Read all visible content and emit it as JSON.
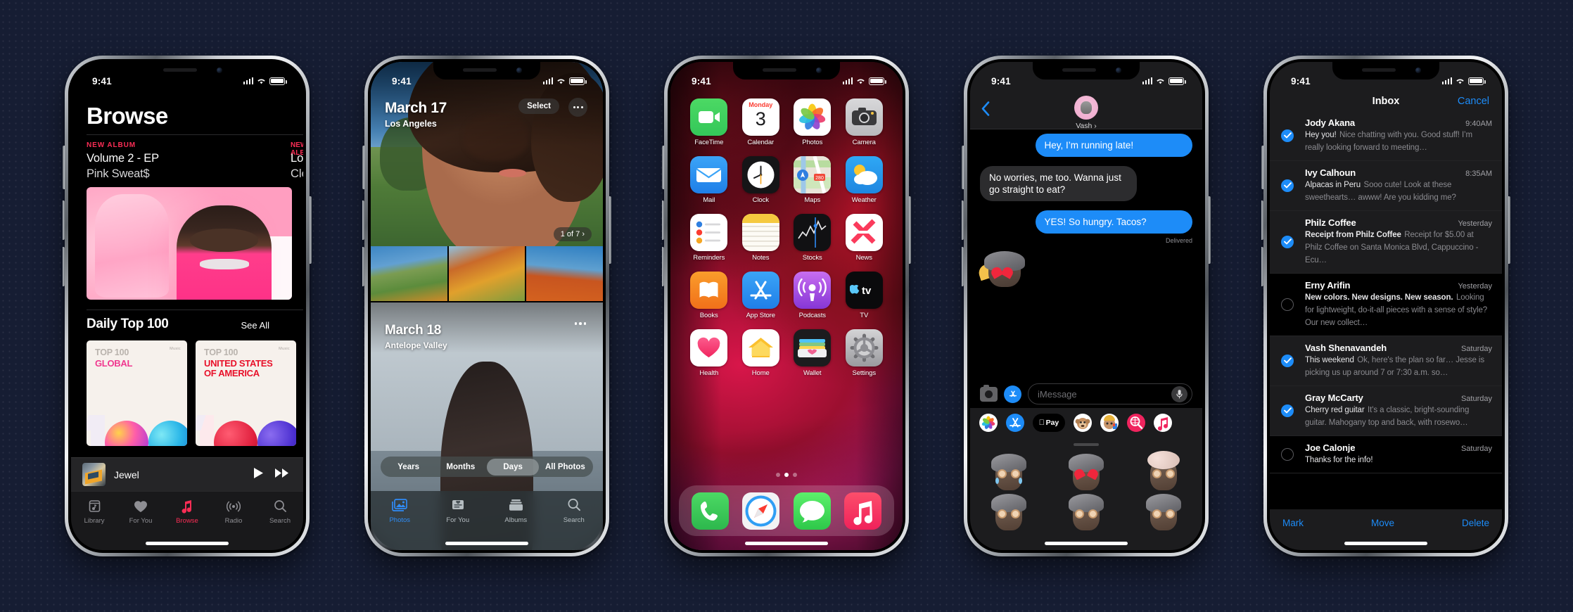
{
  "status_bar": {
    "time": "9:41",
    "signal_icon": "cellular-bars-icon",
    "wifi_icon": "wifi-icon",
    "battery_icon": "battery-icon"
  },
  "phones": [
    {
      "id": "music",
      "app": "Apple Music",
      "page_title": "Browse",
      "eyebrow": "NEW ALBUM",
      "album_title": "Volume 2 - EP",
      "album_artist": "Pink Sweat$",
      "eyebrow2": "NEW ALBUM",
      "album_title2": "Love Goes",
      "album_artist2": "Cloudy",
      "section_title": "Daily Top 100",
      "see_all": "See All",
      "cards": [
        {
          "top": "TOP 100",
          "name": "GLOBAL",
          "badge": "Music"
        },
        {
          "top": "TOP 100",
          "name": "UNITED STATES OF AMERICA",
          "badge": "Music"
        }
      ],
      "now_playing": {
        "track": "Jewel",
        "play_icon": "play-icon",
        "next_icon": "fast-forward-icon"
      },
      "tabs": [
        {
          "label": "Library",
          "icon": "library-icon",
          "active": false
        },
        {
          "label": "For You",
          "icon": "heart-icon",
          "active": false
        },
        {
          "label": "Browse",
          "icon": "music-note-icon",
          "active": true
        },
        {
          "label": "Radio",
          "icon": "radio-waves-icon",
          "active": false
        },
        {
          "label": "Search",
          "icon": "search-icon",
          "active": false
        }
      ]
    },
    {
      "id": "photos",
      "app": "Photos",
      "day1": {
        "date": "March 17",
        "location": "Los Angeles",
        "select_label": "Select",
        "more_icon": "more-dots-icon",
        "count_label": "1 of 7 ›"
      },
      "day2": {
        "date": "March 18",
        "location": "Antelope Valley",
        "more_icon": "more-dots-icon"
      },
      "segments": [
        {
          "label": "Years",
          "active": false
        },
        {
          "label": "Months",
          "active": false
        },
        {
          "label": "Days",
          "active": true
        },
        {
          "label": "All Photos",
          "active": false
        }
      ],
      "tabs": [
        {
          "label": "Photos",
          "icon": "photos-icon",
          "active": true
        },
        {
          "label": "For You",
          "icon": "for-you-icon",
          "active": false
        },
        {
          "label": "Albums",
          "icon": "albums-icon",
          "active": false
        },
        {
          "label": "Search",
          "icon": "search-icon",
          "active": false
        }
      ]
    },
    {
      "id": "homescreen",
      "app": "Home Screen",
      "apps": [
        {
          "label": "FaceTime",
          "icon": "facetime-icon"
        },
        {
          "label": "Calendar",
          "icon": "calendar-icon",
          "weekday": "Monday",
          "day": "3"
        },
        {
          "label": "Photos",
          "icon": "photos-icon"
        },
        {
          "label": "Camera",
          "icon": "camera-icon"
        },
        {
          "label": "Mail",
          "icon": "mail-icon"
        },
        {
          "label": "Clock",
          "icon": "clock-icon"
        },
        {
          "label": "Maps",
          "icon": "maps-icon"
        },
        {
          "label": "Weather",
          "icon": "weather-icon"
        },
        {
          "label": "Reminders",
          "icon": "reminders-icon"
        },
        {
          "label": "Notes",
          "icon": "notes-icon"
        },
        {
          "label": "Stocks",
          "icon": "stocks-icon"
        },
        {
          "label": "News",
          "icon": "news-icon"
        },
        {
          "label": "Books",
          "icon": "books-icon"
        },
        {
          "label": "App Store",
          "icon": "app-store-icon"
        },
        {
          "label": "Podcasts",
          "icon": "podcasts-icon"
        },
        {
          "label": "TV",
          "icon": "apple-tv-icon"
        },
        {
          "label": "Health",
          "icon": "health-icon"
        },
        {
          "label": "Home",
          "icon": "home-icon"
        },
        {
          "label": "Wallet",
          "icon": "wallet-icon"
        },
        {
          "label": "Settings",
          "icon": "settings-icon"
        }
      ],
      "dock": [
        {
          "label": "Phone",
          "icon": "phone-icon"
        },
        {
          "label": "Safari",
          "icon": "safari-icon"
        },
        {
          "label": "Messages",
          "icon": "messages-icon"
        },
        {
          "label": "Music",
          "icon": "music-icon"
        }
      ],
      "page_dots": {
        "count": 3,
        "active_index": 1
      }
    },
    {
      "id": "messages",
      "app": "Messages",
      "back_icon": "chevron-left-icon",
      "contact": "Vash ›",
      "messages": [
        {
          "from": "me",
          "text": "Hey, I’m running late!"
        },
        {
          "from": "them",
          "text": "No worries, me too. Wanna just go straight to eat?"
        },
        {
          "from": "me",
          "text": "YES! So hungry. Tacos?"
        }
      ],
      "delivered_label": "Delivered",
      "input": {
        "placeholder": "iMessage",
        "camera_icon": "camera-icon",
        "apps_icon": "app-store-icon",
        "mic_icon": "microphone-icon"
      },
      "app_strip": [
        {
          "name": "photos-icon"
        },
        {
          "name": "app-store-icon"
        },
        {
          "name": "apple-pay-icon",
          "label": "Pay"
        },
        {
          "name": "animoji-icon"
        },
        {
          "name": "memoji-icon"
        },
        {
          "name": "images-search-icon"
        },
        {
          "name": "music-icon"
        }
      ]
    },
    {
      "id": "mail",
      "app": "Mail",
      "title": "Inbox",
      "cancel_label": "Cancel",
      "emails": [
        {
          "sender": "Jody Akana",
          "time": "9:40AM",
          "subject": "Hey you!",
          "preview": "Nice chatting with you. Good stuff! I’m really looking forward to meeting…",
          "selected": true,
          "bold_subject": false
        },
        {
          "sender": "Ivy Calhoun",
          "time": "8:35AM",
          "subject": "Alpacas in Peru",
          "preview": "Sooo cute! Look at these sweethearts… awww! Are you kidding me?",
          "selected": true,
          "bold_subject": false
        },
        {
          "sender": "Philz Coffee",
          "time": "Yesterday",
          "subject": "Receipt from Philz Coffee",
          "preview": "Receipt for $5.00 at Philz Coffee on Santa Monica Blvd, Cappuccino - Ecu…",
          "selected": true,
          "bold_subject": true
        },
        {
          "sender": "Erny Arifin",
          "time": "Yesterday",
          "subject": "New colors. New designs. New season.",
          "preview": "Looking for lightweight, do-it-all pieces with a sense of style? Our new collect…",
          "selected": false,
          "bold_subject": true
        },
        {
          "sender": "Vash Shenavandeh",
          "time": "Saturday",
          "subject": "This weekend",
          "preview": "Ok, here's the plan so far… Jesse is picking us up around 7 or 7:30 a.m. so…",
          "selected": true,
          "bold_subject": false
        },
        {
          "sender": "Gray McCarty",
          "time": "Saturday",
          "subject": "Cherry red guitar",
          "preview": "It's a classic, bright-sounding guitar. Mahogany top and back, with rosewo…",
          "selected": true,
          "bold_subject": false
        },
        {
          "sender": "Joe Calonje",
          "time": "Saturday",
          "subject": "Thanks for the info!",
          "preview": "",
          "selected": false,
          "bold_subject": false
        }
      ],
      "toolbar": [
        {
          "label": "Mark"
        },
        {
          "label": "Move"
        },
        {
          "label": "Delete"
        }
      ]
    }
  ],
  "colors": {
    "background": "#161d33",
    "music_accent": "#fa2d55",
    "ios_blue": "#1d8cf8",
    "photos_blue": "#2f8cf7"
  }
}
